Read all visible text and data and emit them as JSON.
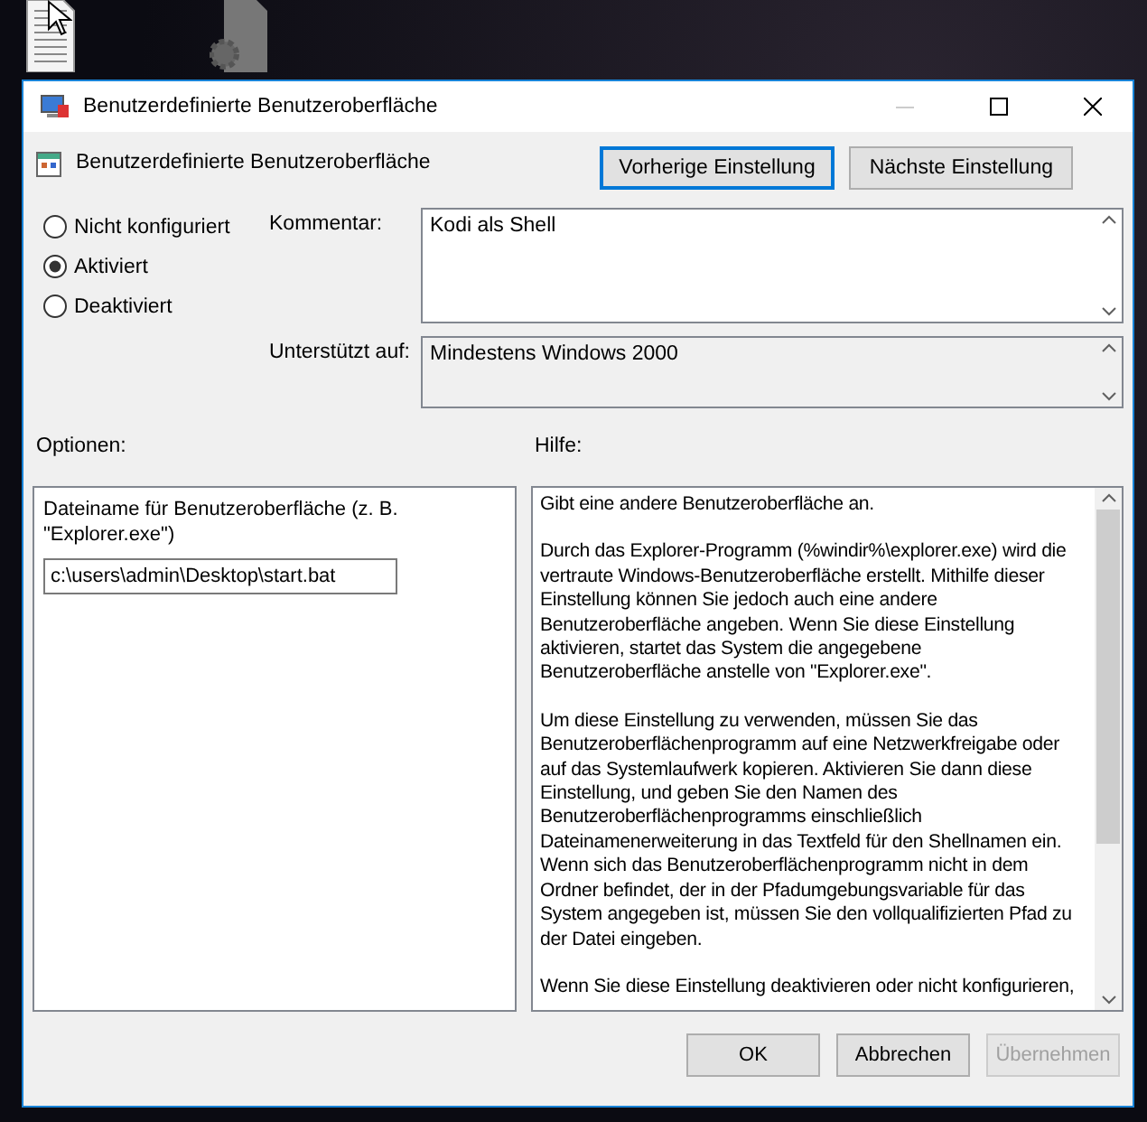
{
  "window": {
    "title": "Benutzerdefinierte Benutzeroberfläche"
  },
  "header": {
    "setting_name": "Benutzerdefinierte Benutzeroberfläche",
    "buttons": [
      "Vorherige Einstellung",
      "Nächste Einstellung"
    ]
  },
  "state_options": [
    {
      "label": "Nicht konfiguriert",
      "selected": false
    },
    {
      "label": "Aktiviert",
      "selected": true
    },
    {
      "label": "Deaktiviert",
      "selected": false
    }
  ],
  "comment": {
    "label": "Kommentar:",
    "value": "Kodi als Shell"
  },
  "supported_on": {
    "label": "Unterstützt auf:",
    "value": "Mindestens Windows 2000"
  },
  "options": {
    "label": "Optionen:",
    "field_label": "Dateiname für Benutzeroberfläche (z. B. \"Explorer.exe\")",
    "value": "c:\\users\\admin\\Desktop\\start.bat"
  },
  "help": {
    "label": "Hilfe:",
    "paragraphs": [
      [
        "Gibt eine andere Benutzeroberfläche an."
      ],
      [
        "Durch das Explorer-Programm (%windir%\\explorer.exe) wird die",
        "vertraute Windows-Benutzeroberfläche erstellt. Mithilfe dieser",
        "Einstellung können Sie jedoch auch eine andere",
        "Benutzeroberfläche angeben. Wenn Sie diese Einstellung",
        "aktivieren, startet das System die angegebene",
        "Benutzeroberfläche anstelle von \"Explorer.exe\"."
      ],
      [
        "Um diese Einstellung zu verwenden, müssen Sie das",
        "Benutzeroberflächenprogramm auf eine Netzwerkfreigabe oder",
        "auf das Systemlaufwerk kopieren. Aktivieren Sie dann diese",
        "Einstellung, und geben Sie den Namen des",
        "Benutzeroberflächenprogramms einschließlich",
        "Dateinamenerweiterung in das Textfeld für den Shellnamen ein.",
        "Wenn sich das Benutzeroberflächenprogramm nicht in dem",
        "Ordner befindet, der in der Pfadumgebungsvariable für das",
        "System angegeben ist, müssen Sie den vollqualifizierten Pfad zu",
        "der Datei eingeben."
      ],
      [
        "Wenn Sie diese Einstellung deaktivieren oder nicht konfigurieren,"
      ]
    ]
  },
  "footer_buttons": [
    {
      "label": "OK",
      "disabled": false
    },
    {
      "label": "Abbrechen",
      "disabled": false
    },
    {
      "label": "Übernehmen",
      "disabled": true
    }
  ]
}
